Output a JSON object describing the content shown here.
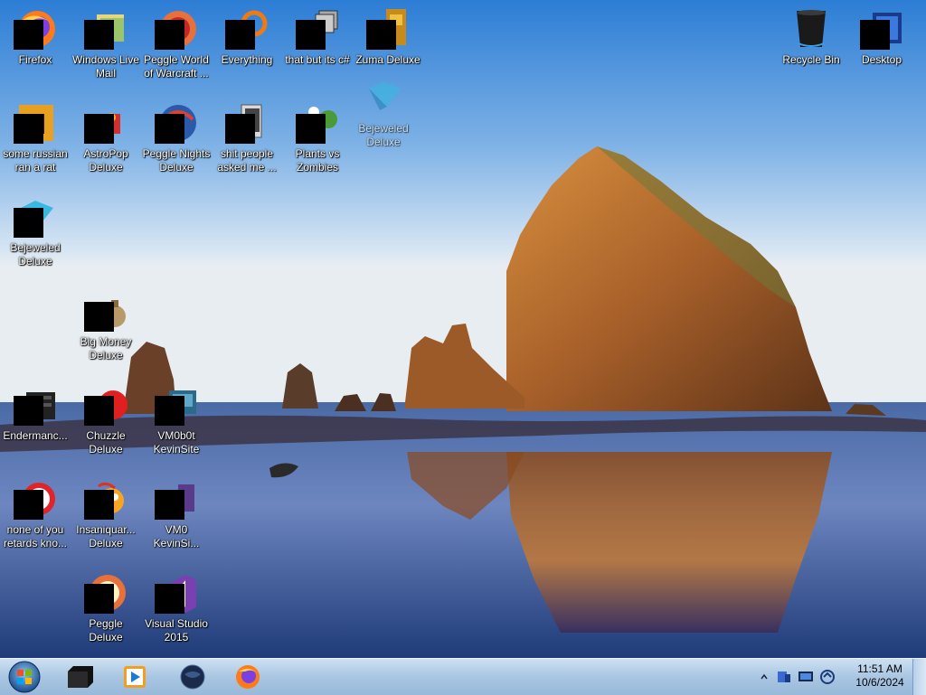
{
  "desktop": {
    "icons": [
      {
        "label": "Firefox"
      },
      {
        "label": "Windows Live Mail"
      },
      {
        "label": "Peggle World of Warcraft ..."
      },
      {
        "label": "Everything"
      },
      {
        "label": "that but its c#"
      },
      {
        "label": "Zuma Deluxe"
      },
      {
        "label": "some russian ran a rat"
      },
      {
        "label": "AstroPop Deluxe"
      },
      {
        "label": "Peggle Nights Deluxe"
      },
      {
        "label": "shit people asked me ..."
      },
      {
        "label": "Plants vs Zombies"
      },
      {
        "label": "Bejeweled Deluxe"
      },
      {
        "label": "Bejeweled Deluxe"
      },
      {
        "label": "Big Money Deluxe"
      },
      {
        "label": "Endermanc..."
      },
      {
        "label": "Chuzzle Deluxe"
      },
      {
        "label": "VM0b0t KevinSite"
      },
      {
        "label": "none of you retards kno..."
      },
      {
        "label": "Insaniquar... Deluxe"
      },
      {
        "label": "VM0 KevinSi..."
      },
      {
        "label": "Peggle Deluxe"
      },
      {
        "label": "Visual Studio 2015"
      },
      {
        "label": "Recycle Bin"
      },
      {
        "label": "Desktop"
      }
    ]
  },
  "taskbar": {
    "start": {
      "icon": "windows-start-orb-icon"
    },
    "pinned": [
      {
        "icon": "black-box-app-icon"
      },
      {
        "icon": "media-player-icon"
      },
      {
        "icon": "dark-globe-app-icon"
      },
      {
        "icon": "firefox-icon"
      }
    ],
    "tray": {
      "icons": [
        "show-hidden-icons-chevron",
        "network-icon",
        "display-icon",
        "action-center-icon"
      ],
      "time": "11:51 AM",
      "date": "10/6/2024"
    }
  },
  "colors": {
    "sky_top": "#2f7fd6",
    "sky_bottom": "#d8e6f4",
    "rock": "#b2692c",
    "sea": "#2d4f8f",
    "taskbar": "#b6cfe8"
  }
}
